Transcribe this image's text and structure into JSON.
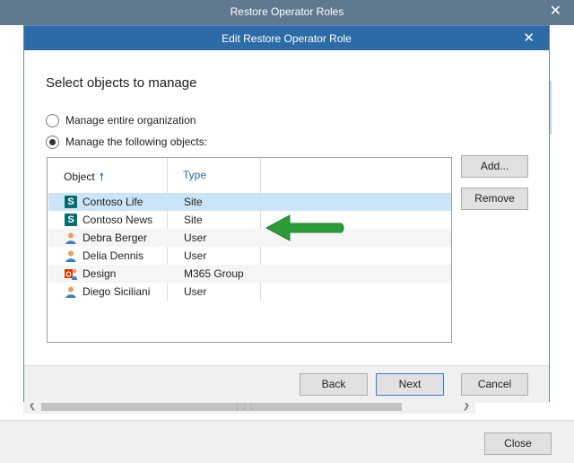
{
  "outer_window": {
    "title": "Restore Operator Roles",
    "close_icon": "close-icon",
    "close_label": "Close"
  },
  "dialog": {
    "title": "Edit Restore Operator Role",
    "close_icon": "close-icon",
    "heading": "Select objects to manage",
    "options": [
      {
        "label": "Manage entire organization",
        "checked": false
      },
      {
        "label": "Manage the following objects:",
        "checked": true
      }
    ],
    "table": {
      "columns": [
        "Object",
        "Type"
      ],
      "sort_icon": "sort-ascending-icon",
      "rows": [
        {
          "icon": "sharepoint-site-icon",
          "name": "Contoso Life",
          "type": "Site",
          "selected": true
        },
        {
          "icon": "sharepoint-site-icon",
          "name": "Contoso News",
          "type": "Site",
          "selected": false
        },
        {
          "icon": "user-icon",
          "name": "Debra Berger",
          "type": "User",
          "selected": false
        },
        {
          "icon": "user-icon",
          "name": "Delia Dennis",
          "type": "User",
          "selected": false
        },
        {
          "icon": "group-icon",
          "name": "Design",
          "type": "M365 Group",
          "selected": false
        },
        {
          "icon": "user-icon",
          "name": "Diego Siciliani",
          "type": "User",
          "selected": false
        }
      ]
    },
    "side_buttons": {
      "add": "Add...",
      "remove": "Remove"
    },
    "footer_buttons": {
      "back": "Back",
      "next": "Next",
      "cancel": "Cancel"
    },
    "annotation_arrow_color": "#2e9a3a"
  },
  "colors": {
    "outer_titlebar": "#60798e",
    "dialog_titlebar": "#2d6ba6",
    "selected_row": "#cce4f7"
  }
}
